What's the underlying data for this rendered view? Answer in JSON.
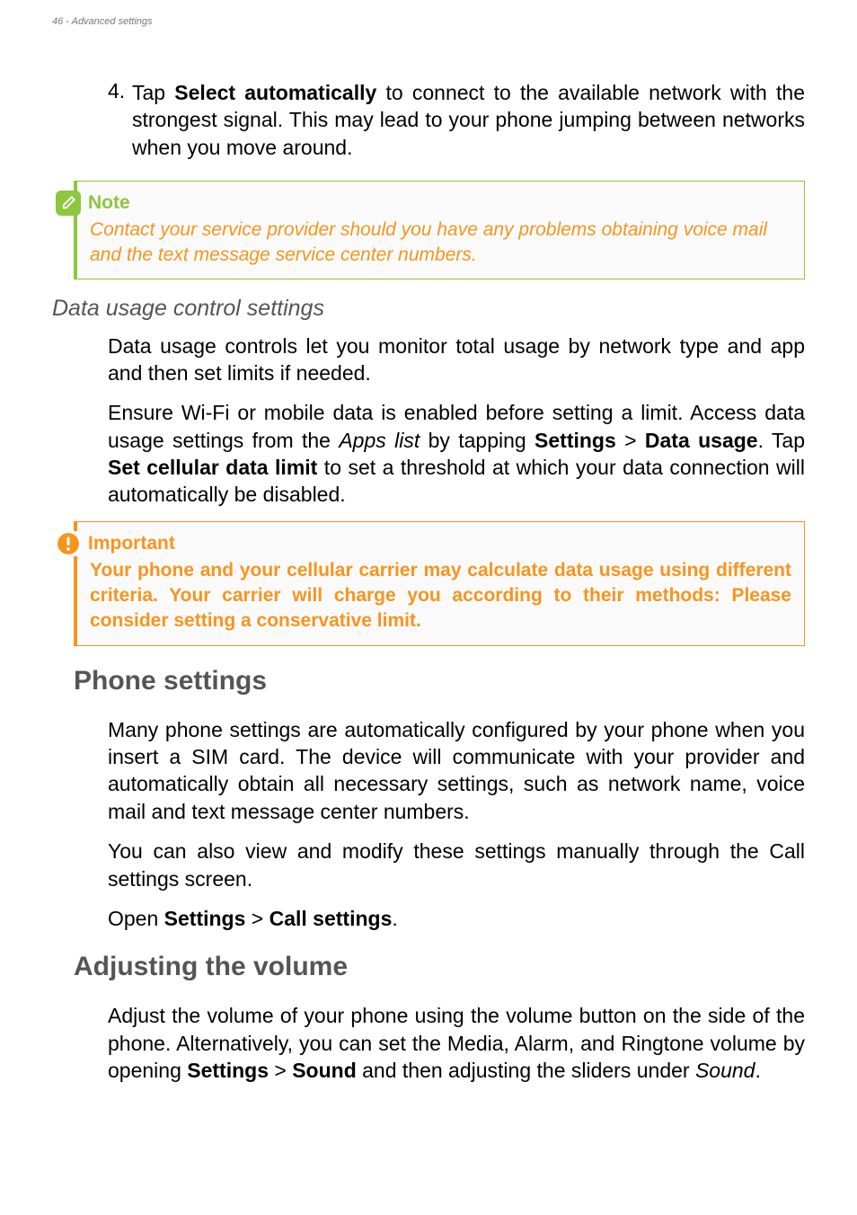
{
  "header": {
    "text": "46 - Advanced settings"
  },
  "step4": {
    "marker": "4.",
    "before": "Tap ",
    "bold1": "Select automatically",
    "after": " to connect to the available network with the strongest signal. This may lead to your phone jumping between networks when you move around."
  },
  "note": {
    "title": "Note",
    "body": "Contact your service provider should you have any problems obtaining voice mail and the text message service center numbers."
  },
  "dataUsage": {
    "heading": "Data usage control settings",
    "p1": "Data usage controls let you monitor total usage by network type and app and then set limits if needed.",
    "p2a": "Ensure Wi-Fi or mobile data is enabled before setting a limit. Access data usage settings from the ",
    "p2i": "Apps list",
    "p2b": " by tapping ",
    "p2bold1": "Settings",
    "p2gt": " > ",
    "p2bold2": "Data usage",
    "p2c": ". Tap ",
    "p2bold3": "Set cellular data limit",
    "p2d": " to set a threshold at which your data connection will automatically be disabled."
  },
  "important": {
    "title": "Important",
    "body": "Your phone and your cellular carrier may calculate data usage using different criteria. Your carrier will charge you according to their methods: Please consider setting a conservative limit."
  },
  "phoneSettings": {
    "heading": "Phone settings",
    "p1": "Many phone settings are automatically configured by your phone when you insert a SIM card. The device will communicate with your provider and automatically obtain all necessary settings, such as network name, voice mail and text message center numbers.",
    "p2": "You can also view and modify these settings manually through the Call settings screen.",
    "p3a": "Open ",
    "p3bold1": "Settings",
    "p3gt": " > ",
    "p3bold2": "Call settings",
    "p3b": "."
  },
  "volume": {
    "heading": "Adjusting the volume",
    "p1a": "Adjust the volume of your phone using the volume button on the side of the phone. Alternatively, you can set the Media, Alarm, and Ringtone volume by opening ",
    "p1bold1": "Settings",
    "p1gt": " > ",
    "p1bold2": "Sound",
    "p1b": " and then adjusting the sliders under ",
    "p1i": "Sound",
    "p1c": "."
  }
}
